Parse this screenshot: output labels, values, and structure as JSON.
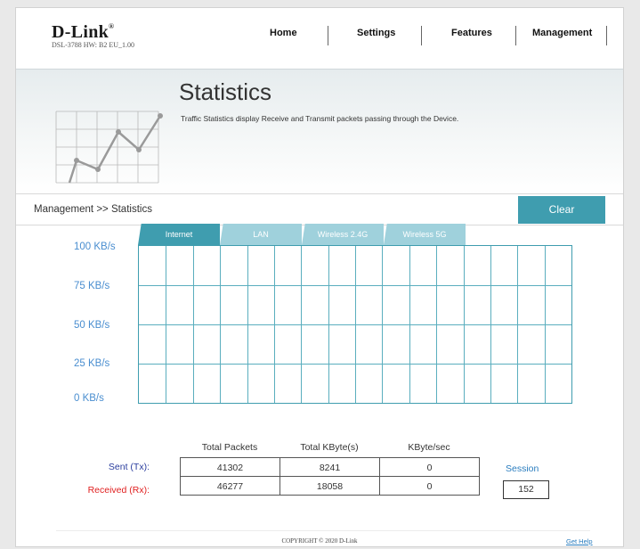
{
  "header": {
    "logo": "D-Link",
    "model_info": "DSL-3788  HW: B2  EU_1.00",
    "nav": [
      "Home",
      "Settings",
      "Features",
      "Management"
    ]
  },
  "banner": {
    "title": "Statistics",
    "description": "Traffic Statistics display Receive and Transmit packets passing through the Device."
  },
  "breadcrumb": "Management >> Statistics",
  "clear_label": "Clear",
  "tabs": [
    {
      "label": "Internet",
      "active": true
    },
    {
      "label": "LAN",
      "active": false
    },
    {
      "label": "Wireless 2.4G",
      "active": false
    },
    {
      "label": "Wireless 5G",
      "active": false
    }
  ],
  "chart": {
    "y_labels": [
      "100 KB/s",
      "75 KB/s",
      "50 KB/s",
      "25 KB/s",
      "0 KB/s"
    ]
  },
  "table": {
    "headers": [
      "Total Packets",
      "Total KByte(s)",
      "KByte/sec"
    ],
    "sent_label": "Sent (Tx):",
    "received_label": "Received (Rx):",
    "sent": [
      "41302",
      "8241",
      "0"
    ],
    "received": [
      "46277",
      "18058",
      "0"
    ],
    "session_label": "Session",
    "session_value": "152"
  },
  "footer": {
    "copyright": "COPYRIGHT © 2020 D-Link",
    "help": "Get Help"
  },
  "colors": {
    "accent": "#3f9daf",
    "tab_inactive": "#9fd1dc",
    "sent_label": "#2a3d9e",
    "received_label": "#e02020",
    "y_label": "#4a8ed0"
  }
}
